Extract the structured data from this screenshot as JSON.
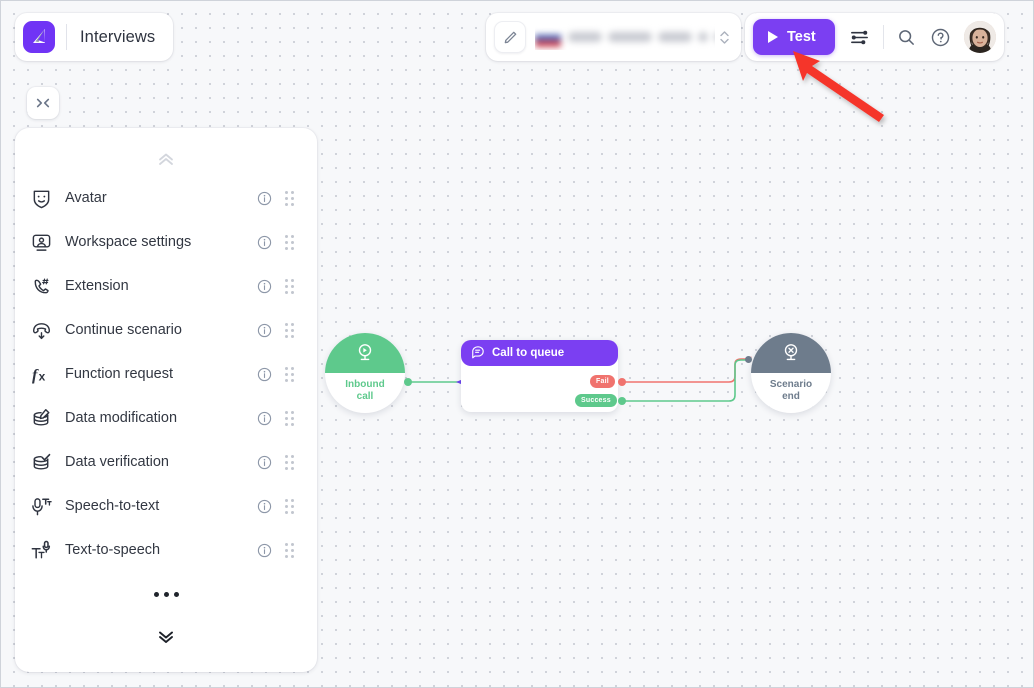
{
  "app": {
    "title": "Interviews",
    "logo_icon": "app-logo-icon"
  },
  "center_bar": {
    "edit_icon": "pencil-icon",
    "selected_value": "",
    "redacted": true,
    "stepper_icon": "chevron-up-down-icon"
  },
  "actions": {
    "test_label": "Test",
    "play_icon": "play-icon",
    "settings_icon": "sliders-icon",
    "search_icon": "search-icon",
    "help_icon": "question-circle-icon",
    "avatar_icon": "user-avatar"
  },
  "annotation": {
    "arrow_icon": "red-pointer-arrow",
    "color": "#f5352c"
  },
  "canvas": {
    "collapse_icon": "collapse-horizontal-icon",
    "background": "#f7f8fa",
    "dot_color": "#c9ccd4"
  },
  "panel": {
    "scroll_up_icon": "chevron-double-up-icon",
    "scroll_down_icon": "chevron-double-down-icon",
    "more_icon": "ellipsis-icon",
    "info_icon": "info-circle-icon",
    "drag_icon": "drag-grip-icon",
    "items": [
      {
        "label": "Avatar",
        "icon": "theatre-mask-icon"
      },
      {
        "label": "Workspace settings",
        "icon": "workspace-user-icon"
      },
      {
        "label": "Extension",
        "icon": "phone-hash-icon"
      },
      {
        "label": "Continue scenario",
        "icon": "phone-down-arrow-icon"
      },
      {
        "label": "Function request",
        "icon": "function-fx-icon"
      },
      {
        "label": "Data modification",
        "icon": "database-edit-icon"
      },
      {
        "label": "Data verification",
        "icon": "database-check-icon"
      },
      {
        "label": "Speech-to-text",
        "icon": "microphone-text-icon"
      },
      {
        "label": "Text-to-speech",
        "icon": "text-microphone-icon"
      }
    ]
  },
  "flow": {
    "start_node": {
      "label": "Inbound\ncall",
      "label_line1": "Inbound",
      "label_line2": "call",
      "icon": "inbound-call-icon",
      "color": "#5ec98c"
    },
    "queue_node": {
      "title": "Call to queue",
      "icon": "queue-icon",
      "color": "#7b3ff2",
      "outputs": [
        {
          "label": "Fail",
          "color": "#f0736e"
        },
        {
          "label": "Success",
          "color": "#5ec98c"
        }
      ]
    },
    "end_node": {
      "label_line1": "Scenario",
      "label_line2": "end",
      "icon": "scenario-end-icon",
      "color": "#6e7c8c"
    }
  }
}
